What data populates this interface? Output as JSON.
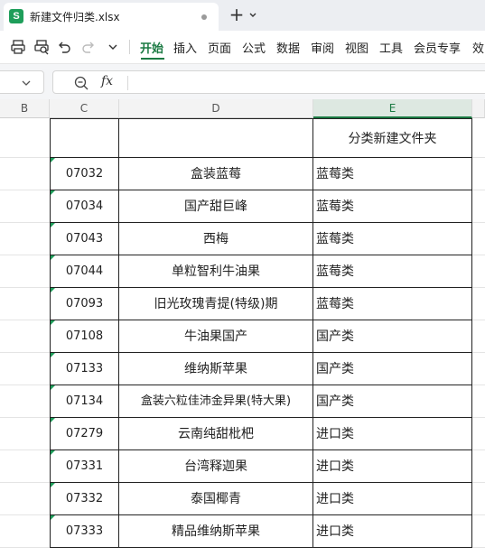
{
  "app": {
    "logo_letter": "S",
    "doc_title": "新建文件归类.xlsx"
  },
  "icons": {
    "new_tab": "plus-icon",
    "tab_menu": "chevron-down-icon",
    "toolbar": [
      "print-icon",
      "print-preview-icon",
      "undo-icon",
      "redo-icon",
      "more-chevron-icon"
    ],
    "zoom": "zoom-icon",
    "fx": "fx-icon"
  },
  "ribbon": {
    "tabs": [
      "开始",
      "插入",
      "页面",
      "公式",
      "数据",
      "审阅",
      "视图",
      "工具",
      "会员专享",
      "效"
    ],
    "active": "开始"
  },
  "formula_bar": {
    "fx_label": "fx",
    "formula": ""
  },
  "columns": [
    "B",
    "C",
    "D",
    "E"
  ],
  "selected_column": "E",
  "header_row": {
    "code": "",
    "name": "",
    "category": "分类新建文件夹"
  },
  "rows": [
    {
      "code": "07032",
      "name": "盒装蓝莓",
      "category": "蓝莓类"
    },
    {
      "code": "07034",
      "name": "国产甜巨峰",
      "category": "蓝莓类"
    },
    {
      "code": "07043",
      "name": "西梅",
      "category": "蓝莓类"
    },
    {
      "code": "07044",
      "name": "单粒智利牛油果",
      "category": "蓝莓类"
    },
    {
      "code": "07093",
      "name": "旧光玫瑰青提(特级)期",
      "category": "蓝莓类"
    },
    {
      "code": "07108",
      "name": "牛油果国产",
      "category": "国产类"
    },
    {
      "code": "07133",
      "name": "维纳斯苹果",
      "category": "国产类"
    },
    {
      "code": "07134",
      "name": "盒装六粒佳沛金异果(特大果)",
      "category": "国产类"
    },
    {
      "code": "07279",
      "name": "云南纯甜枇杷",
      "category": "进口类"
    },
    {
      "code": "07331",
      "name": "台湾释迦果",
      "category": "进口类"
    },
    {
      "code": "07332",
      "name": "泰国椰青",
      "category": "进口类"
    },
    {
      "code": "07333",
      "name": "精品维纳斯苹果",
      "category": "进口类"
    }
  ],
  "colors": {
    "accent": "#1b7a43",
    "logo": "#1e9e5a",
    "cell_border": "#222222"
  }
}
